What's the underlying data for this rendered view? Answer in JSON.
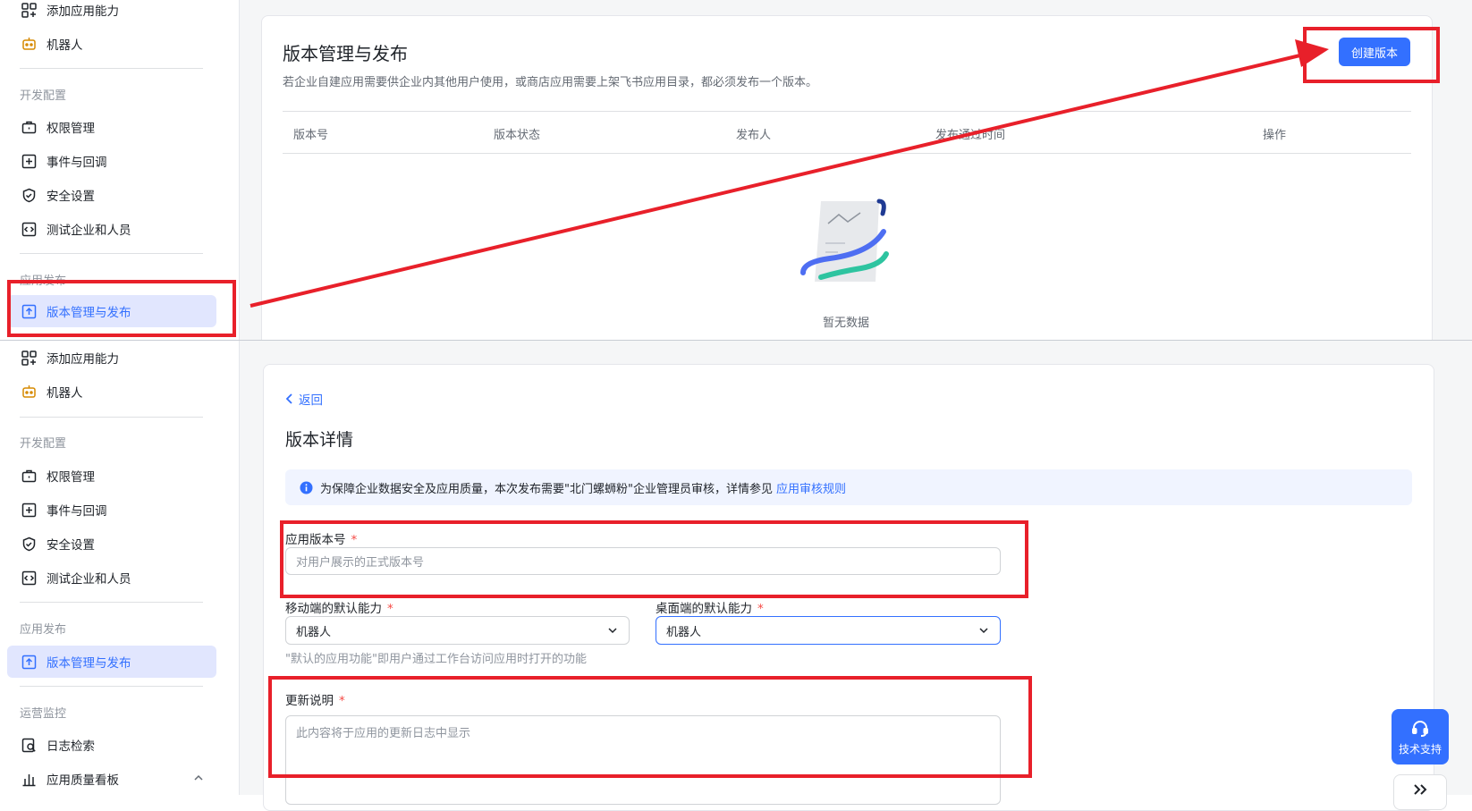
{
  "colors": {
    "accent": "#3370ff",
    "annotation_red": "#e8202a",
    "active_bg": "#e1e6fe"
  },
  "top": {
    "sidebar": {
      "items": [
        {
          "label": "添加应用能力",
          "icon": "apps-add-icon"
        },
        {
          "label": "机器人",
          "icon": "robot-icon"
        }
      ],
      "group_dev": "开发配置",
      "dev_items": [
        {
          "label": "权限管理",
          "icon": "briefcase-lock-icon"
        },
        {
          "label": "事件与回调",
          "icon": "event-callback-icon"
        },
        {
          "label": "安全设置",
          "icon": "shield-icon"
        },
        {
          "label": "测试企业和人员",
          "icon": "code-box-icon"
        }
      ],
      "group_publish": "应用发布",
      "publish_items": [
        {
          "label": "版本管理与发布",
          "icon": "upload-box-icon",
          "active": true
        }
      ]
    },
    "page_title": "版本管理与发布",
    "page_subtitle": "若企业自建应用需要供企业内其他用户使用，或商店应用需要上架飞书应用目录，都必须发布一个版本。",
    "create_button": "创建版本",
    "table": {
      "columns": [
        "版本号",
        "版本状态",
        "发布人",
        "发布通过时间",
        "操作"
      ]
    },
    "empty_text": "暂无数据"
  },
  "bottom": {
    "sidebar": {
      "items": [
        {
          "label": "添加应用能力",
          "icon": "apps-add-icon"
        },
        {
          "label": "机器人",
          "icon": "robot-icon"
        }
      ],
      "group_dev": "开发配置",
      "dev_items": [
        {
          "label": "权限管理",
          "icon": "briefcase-lock-icon"
        },
        {
          "label": "事件与回调",
          "icon": "event-callback-icon"
        },
        {
          "label": "安全设置",
          "icon": "shield-icon"
        },
        {
          "label": "测试企业和人员",
          "icon": "code-box-icon"
        }
      ],
      "group_publish": "应用发布",
      "publish_items": [
        {
          "label": "版本管理与发布",
          "icon": "upload-box-icon",
          "active": true
        }
      ],
      "group_ops": "运营监控",
      "ops_items": [
        {
          "label": "日志检索",
          "icon": "log-search-icon"
        },
        {
          "label": "应用质量看板",
          "icon": "bar-chart-icon"
        }
      ]
    },
    "back_label": "返回",
    "page_title": "版本详情",
    "banner": {
      "text": "为保障企业数据安全及应用质量，本次发布需要\"北门螺蛳粉\"企业管理员审核，详情参见",
      "link": "应用审核规则"
    },
    "form": {
      "version_label": "应用版本号",
      "version_placeholder": "对用户展示的正式版本号",
      "mobile_label": "移动端的默认能力",
      "mobile_value": "机器人",
      "desktop_label": "桌面端的默认能力",
      "desktop_value": "机器人",
      "default_hint": "\"默认的应用功能\"即用户通过工作台访问应用时打开的功能",
      "notes_label": "更新说明",
      "notes_placeholder": "此内容将于应用的更新日志中显示",
      "required_mark": "*"
    },
    "support_label": "技术支持"
  }
}
